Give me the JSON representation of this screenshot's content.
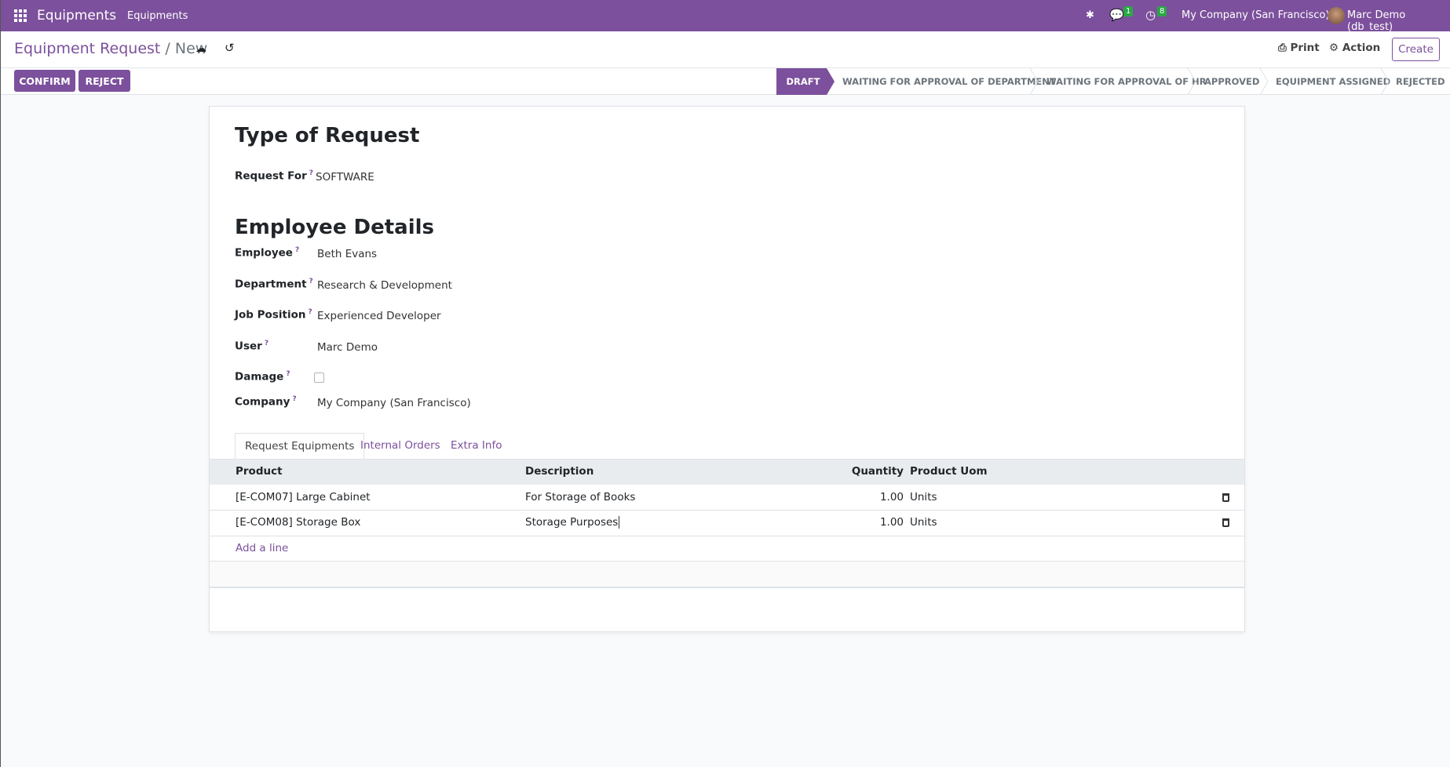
{
  "nav": {
    "app": "Equipments",
    "menu": "Equipments",
    "messages_count": "1",
    "activities_count": "8",
    "company": "My Company (San Francisco)",
    "user": "Marc Demo (db_test)"
  },
  "breadcrumb": {
    "parent": "Equipment Request",
    "separator": "/",
    "current": "New"
  },
  "actions": {
    "print": "Print",
    "action": "Action",
    "create": "Create",
    "confirm": "CONFIRM",
    "reject": "REJECT"
  },
  "statusbar": [
    "DRAFT",
    "WAITING FOR APPROVAL OF DEPARTMENT",
    "WAITING FOR APPROVAL OF HR",
    "APPROVED",
    "EQUIPMENT ASSIGNED",
    "REJECTED"
  ],
  "form": {
    "section1": "Type of Request",
    "request_for": {
      "label": "Request For",
      "value": "SOFTWARE"
    },
    "section2": "Employee Details",
    "fields": [
      {
        "label": "Employee",
        "value": "Beth Evans"
      },
      {
        "label": "Department",
        "value": "Research & Development"
      },
      {
        "label": "Job Position",
        "value": "Experienced Developer"
      },
      {
        "label": "User",
        "value": "Marc Demo"
      }
    ],
    "damage": {
      "label": "Damage",
      "checked": false
    },
    "company": {
      "label": "Company",
      "value": "My Company (San Francisco)"
    },
    "help": "?"
  },
  "tabs": [
    "Request Equipments",
    "Internal Orders",
    "Extra Info"
  ],
  "table": {
    "headers": [
      "Product",
      "Description",
      "Quantity",
      "Product Uom"
    ],
    "rows": [
      {
        "product": "[E-COM07] Large Cabinet",
        "description": "For Storage of Books",
        "quantity": "1.00",
        "uom": "Units"
      },
      {
        "product": "[E-COM08] Storage Box",
        "description": "Storage Purposes",
        "quantity": "1.00",
        "uom": "Units"
      }
    ],
    "add_line": "Add a line"
  }
}
